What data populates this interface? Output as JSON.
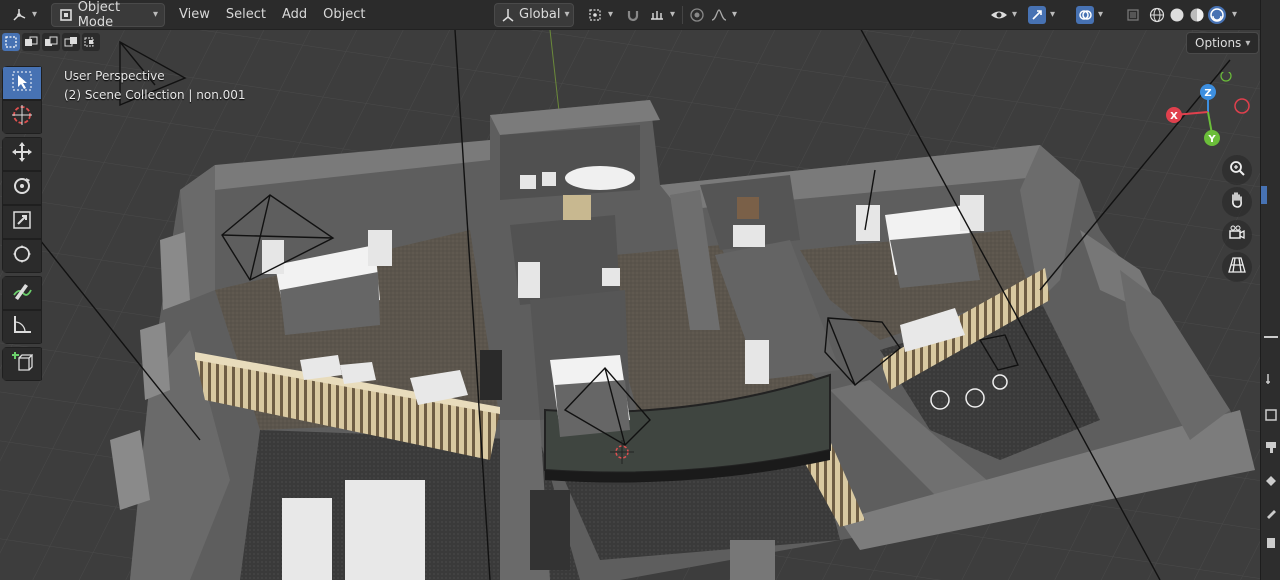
{
  "header": {
    "editor_type_icon": "axes-gizmo-icon",
    "mode_label": "Object Mode",
    "menus": [
      "View",
      "Select",
      "Add",
      "Object"
    ],
    "orientation_label": "Global",
    "options_label": "Options"
  },
  "overlay": {
    "perspective": "User Perspective",
    "collection": "(2) Scene Collection | non.001"
  },
  "gizmo": {
    "z": "Z",
    "x": "X",
    "y": "Y",
    "colors": {
      "x": "#e0404d",
      "y": "#6bbe3a",
      "z": "#3d8fe0"
    }
  },
  "toolbar_tools": [
    "select-box-icon",
    "cursor-icon",
    "move-icon",
    "rotate-icon",
    "scale-icon",
    "transform-icon",
    "annotate-icon",
    "measure-icon",
    "add-cube-icon"
  ],
  "nav_buttons": [
    "zoom-icon",
    "hand-pan-icon",
    "camera-icon",
    "grid-ortho-icon"
  ],
  "colors": {
    "header_bg": "#2b2b2b",
    "accent": "#4772b3",
    "viewport_bg": "#3d3d3d"
  }
}
